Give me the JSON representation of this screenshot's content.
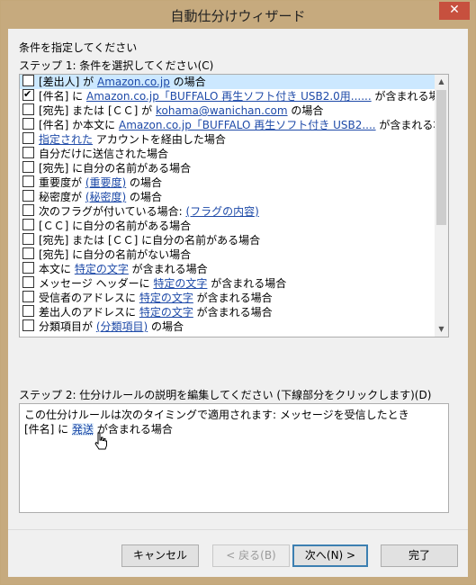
{
  "window": {
    "title": "自動仕分けウィザード",
    "close_label": "✕"
  },
  "step_header": "条件を指定してください",
  "step1_label": "ステップ 1: 条件を選択してください(C)",
  "conditions": [
    {
      "checked": false,
      "selected": true,
      "parts": [
        {
          "t": "[差出人] が "
        },
        {
          "t": "Amazon.co.jp",
          "link": true
        },
        {
          "t": " の場合"
        }
      ]
    },
    {
      "checked": true,
      "selected": false,
      "parts": [
        {
          "t": "[件名] に "
        },
        {
          "t": "Amazon.co.jp「BUFFALO 再生ソフト付き USB2.0用......",
          "link": true
        },
        {
          "t": " が含まれる場合"
        }
      ]
    },
    {
      "checked": false,
      "selected": false,
      "parts": [
        {
          "t": "[宛先] または [ＣＣ] が "
        },
        {
          "t": "kohama@wanichan.com",
          "link": true
        },
        {
          "t": " の場合"
        }
      ]
    },
    {
      "checked": false,
      "selected": false,
      "parts": [
        {
          "t": "[件名] か本文に "
        },
        {
          "t": "Amazon.co.jp「BUFFALO 再生ソフト付き USB2....",
          "link": true
        },
        {
          "t": " が含まれる場合"
        }
      ]
    },
    {
      "checked": false,
      "selected": false,
      "parts": [
        {
          "t": "指定された",
          "link": true
        },
        {
          "t": " アカウントを経由した場合"
        }
      ]
    },
    {
      "checked": false,
      "selected": false,
      "parts": [
        {
          "t": "自分だけに送信された場合"
        }
      ]
    },
    {
      "checked": false,
      "selected": false,
      "parts": [
        {
          "t": "[宛先] に自分の名前がある場合"
        }
      ]
    },
    {
      "checked": false,
      "selected": false,
      "parts": [
        {
          "t": "重要度が "
        },
        {
          "t": "(重要度)",
          "link": true
        },
        {
          "t": " の場合"
        }
      ]
    },
    {
      "checked": false,
      "selected": false,
      "parts": [
        {
          "t": "秘密度が "
        },
        {
          "t": "(秘密度)",
          "link": true
        },
        {
          "t": " の場合"
        }
      ]
    },
    {
      "checked": false,
      "selected": false,
      "parts": [
        {
          "t": "次のフラグが付いている場合: "
        },
        {
          "t": "(フラグの内容)",
          "link": true
        }
      ]
    },
    {
      "checked": false,
      "selected": false,
      "parts": [
        {
          "t": "[ＣＣ] に自分の名前がある場合"
        }
      ]
    },
    {
      "checked": false,
      "selected": false,
      "parts": [
        {
          "t": "[宛先] または [ＣＣ] に自分の名前がある場合"
        }
      ]
    },
    {
      "checked": false,
      "selected": false,
      "parts": [
        {
          "t": "[宛先] に自分の名前がない場合"
        }
      ]
    },
    {
      "checked": false,
      "selected": false,
      "parts": [
        {
          "t": "本文に "
        },
        {
          "t": "特定の文字",
          "link": true
        },
        {
          "t": " が含まれる場合"
        }
      ]
    },
    {
      "checked": false,
      "selected": false,
      "parts": [
        {
          "t": "メッセージ ヘッダーに "
        },
        {
          "t": "特定の文字",
          "link": true
        },
        {
          "t": " が含まれる場合"
        }
      ]
    },
    {
      "checked": false,
      "selected": false,
      "parts": [
        {
          "t": "受信者のアドレスに "
        },
        {
          "t": "特定の文字",
          "link": true
        },
        {
          "t": " が含まれる場合"
        }
      ]
    },
    {
      "checked": false,
      "selected": false,
      "parts": [
        {
          "t": "差出人のアドレスに "
        },
        {
          "t": "特定の文字",
          "link": true
        },
        {
          "t": " が含まれる場合"
        }
      ]
    },
    {
      "checked": false,
      "selected": false,
      "parts": [
        {
          "t": "分類項目が "
        },
        {
          "t": "(分類項目)",
          "link": true
        },
        {
          "t": " の場合"
        }
      ]
    }
  ],
  "step2_label": "ステップ 2: 仕分けルールの説明を編集してください (下線部分をクリックします)(D)",
  "description": {
    "line1": "この仕分けルールは次のタイミングで適用されます: メッセージを受信したとき",
    "line2_prefix": "[件名] に ",
    "line2_link": "発送",
    "line2_suffix": " が含まれる場合"
  },
  "buttons": {
    "cancel": "キャンセル",
    "back": "< 戻る(B)",
    "next": "次へ(N) >",
    "finish": "完了"
  }
}
